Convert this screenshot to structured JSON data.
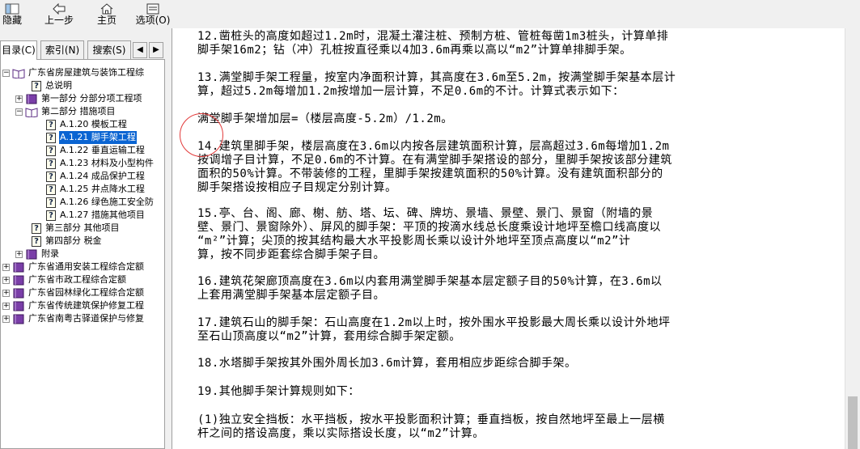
{
  "toolbar": {
    "items": [
      {
        "label": "隐藏",
        "icon": "hide-icon"
      },
      {
        "label": "上一步",
        "icon": "back-arrow-icon"
      },
      {
        "label": "主页",
        "icon": "home-icon"
      },
      {
        "label": "选项(O)",
        "icon": "options-icon"
      }
    ]
  },
  "tabs": [
    "目录(C)",
    "索引(N)",
    "搜索(S)"
  ],
  "tree": {
    "root": "广东省房屋建筑与装饰工程综",
    "general": "总说明",
    "part1": "第一部分 分部分项工程项",
    "part2": "第二部分 措施项目",
    "a120": "A.1.20 模板工程",
    "a121": "A.1.21 脚手架工程",
    "a122": "A.1.22 垂直运输工程",
    "a123": "A.1.23 材料及小型构件",
    "a124": "A.1.24 成品保护工程",
    "a125": "A.1.25 井点降水工程",
    "a126": "A.1.26 绿色施工安全防",
    "a127": "A.1.27 措施其他项目",
    "part3": "第三部分 其他项目",
    "part4": "第四部分 税金",
    "appendix": "附录",
    "other1": "广东省通用安装工程综合定额",
    "other2": "广东省市政工程综合定额",
    "other3": "广东省园林绿化工程综合定额",
    "other4": "广东省传统建筑保护修复工程",
    "other5": "广东省南粤古驿道保护与修复"
  },
  "content": {
    "p12_l1": "12.凿桩头的高度如超过1.2m时，混凝土灌注桩、预制方桩、管桩每凿1m3桩头，计算单排",
    "p12_l2": "脚手架16m2；钻（冲）孔桩按直径乘以4加3.6m再乘以高以“m2”计算单排脚手架。",
    "p13_l1": "13.满堂脚手架工程量，按室内净面积计算，其高度在3.6m至5.2m，按满堂脚手架基本层计",
    "p13_l2": "算，超过5.2m每增加1.2m按增加一层计算，不足0.6m的不计。计算式表示如下：",
    "formula": "满堂脚手架增加层=（楼层高度-5.2m）/1.2m。",
    "p14_l1": "14.建筑里脚手架，楼层高度在3.6m以内按各层建筑面积计算，层高超过3.6m每增加1.2m",
    "p14_l2": "按调增子目计算，不足0.6m的不计算。在有满堂脚手架搭设的部分，里脚手架按该部分建筑",
    "p14_l3": "面积的50%计算。不带装修的工程，里脚手架按建筑面积的50%计算。没有建筑面积部分的",
    "p14_l4": "脚手架搭设按相应子目规定分别计算。",
    "p15_l1": "15.亭、台、阁、廊、榭、舫、塔、坛、碑、牌坊、景墙、景壁、景门、景窗（附墙的景",
    "p15_l2": "壁、景门、景窗除外）、屏风的脚手架：平顶的按滴水线总长度乘设计地坪至檐口线高度以",
    "p15_l3": "“m²”计算；尖顶的按其结构最大水平投影周长乘以设计外地坪至顶点高度以“m2”计",
    "p15_l4": "算，按不同步距套综合脚手架子目。",
    "p16_l1": "16.建筑花架廊顶高度在3.6m以内套用满堂脚手架基本层定额子目的50%计算，在3.6m以",
    "p16_l2": "上套用满堂脚手架基本层定额子目。",
    "p17_l1": "17.建筑石山的脚手架：石山高度在1.2m以上时，按外围水平投影最大周长乘以设计外地坪",
    "p17_l2": "至石山顶高度以“m2”计算，套用综合脚手架定额。",
    "p18": "18.水塔脚手架按其外围外周长加3.6m计算，套用相应步距综合脚手架。",
    "p19": "19.其他脚手架计算规则如下：",
    "p19a_l1": "(1)独立安全挡板：水平挡板，按水平投影面积计算；垂直挡板，按自然地坪至最上一层横",
    "p19a_l2": "杆之间的搭设高度，乘以实际搭设长度，以“m2”计算。"
  }
}
